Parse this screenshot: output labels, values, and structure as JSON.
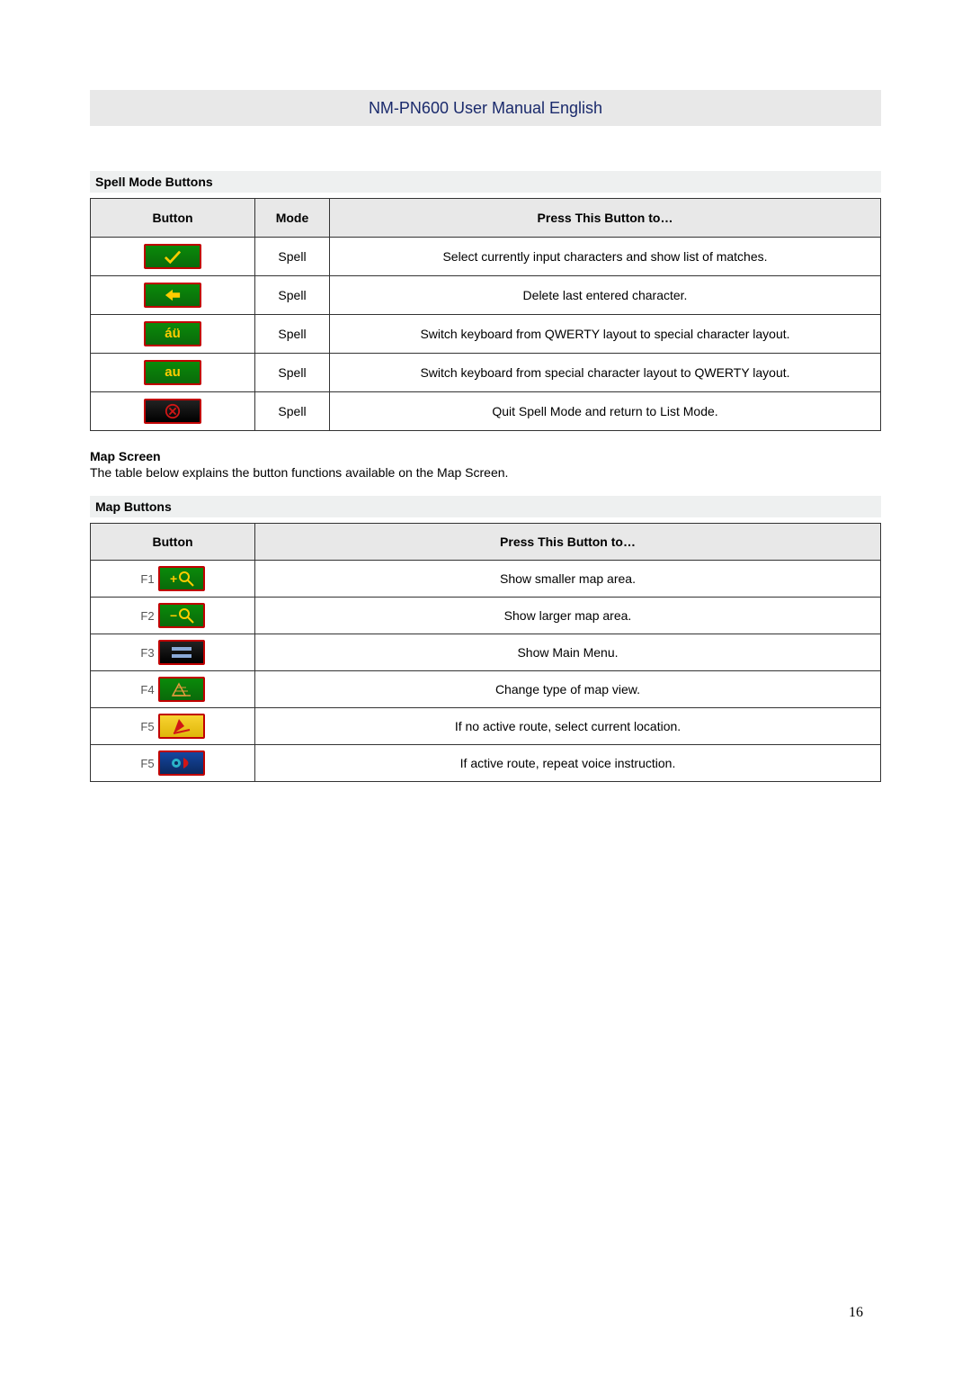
{
  "header": "NM-PN600 User Manual  English",
  "section_spell_title": "Spell Mode Buttons",
  "spell_table": {
    "headers": {
      "button": "Button",
      "mode": "Mode",
      "press": "Press This Button to…"
    },
    "rows": [
      {
        "icon": "check-icon",
        "mode": "Spell",
        "desc": "Select currently input characters and show list of matches."
      },
      {
        "icon": "back-arrow-icon",
        "mode": "Spell",
        "desc": "Delete last entered character."
      },
      {
        "icon": "au-accent-icon",
        "label": "áü",
        "mode": "Spell",
        "desc": "Switch keyboard from QWERTY layout to special character layout."
      },
      {
        "icon": "au-plain-icon",
        "label": "au",
        "mode": "Spell",
        "desc": "Switch keyboard from special character layout to QWERTY layout."
      },
      {
        "icon": "quit-x-icon",
        "mode": "Spell",
        "desc": "Quit Spell Mode and return to List Mode."
      }
    ]
  },
  "map_heading": "Map Screen",
  "map_intro": "The table below explains the button functions available on the Map Screen.",
  "section_map_title": "Map Buttons",
  "map_table": {
    "headers": {
      "button": "Button",
      "press": "Press This Button to…"
    },
    "rows": [
      {
        "fkey": "F1",
        "icon": "zoom-in-icon",
        "color": "green",
        "desc": "Show smaller map area."
      },
      {
        "fkey": "F2",
        "icon": "zoom-out-icon",
        "color": "green",
        "desc": "Show larger map area."
      },
      {
        "fkey": "F3",
        "icon": "main-menu-icon",
        "color": "black",
        "desc": "Show Main Menu."
      },
      {
        "fkey": "F4",
        "icon": "map-view-icon",
        "color": "green",
        "desc": "Change type of map view."
      },
      {
        "fkey": "F5",
        "icon": "location-pin-icon",
        "color": "yellow",
        "desc": "If no active route, select current location."
      },
      {
        "fkey": "F5",
        "icon": "voice-repeat-icon",
        "color": "blue",
        "desc": "If active route, repeat voice instruction."
      }
    ]
  },
  "page_number": "16"
}
